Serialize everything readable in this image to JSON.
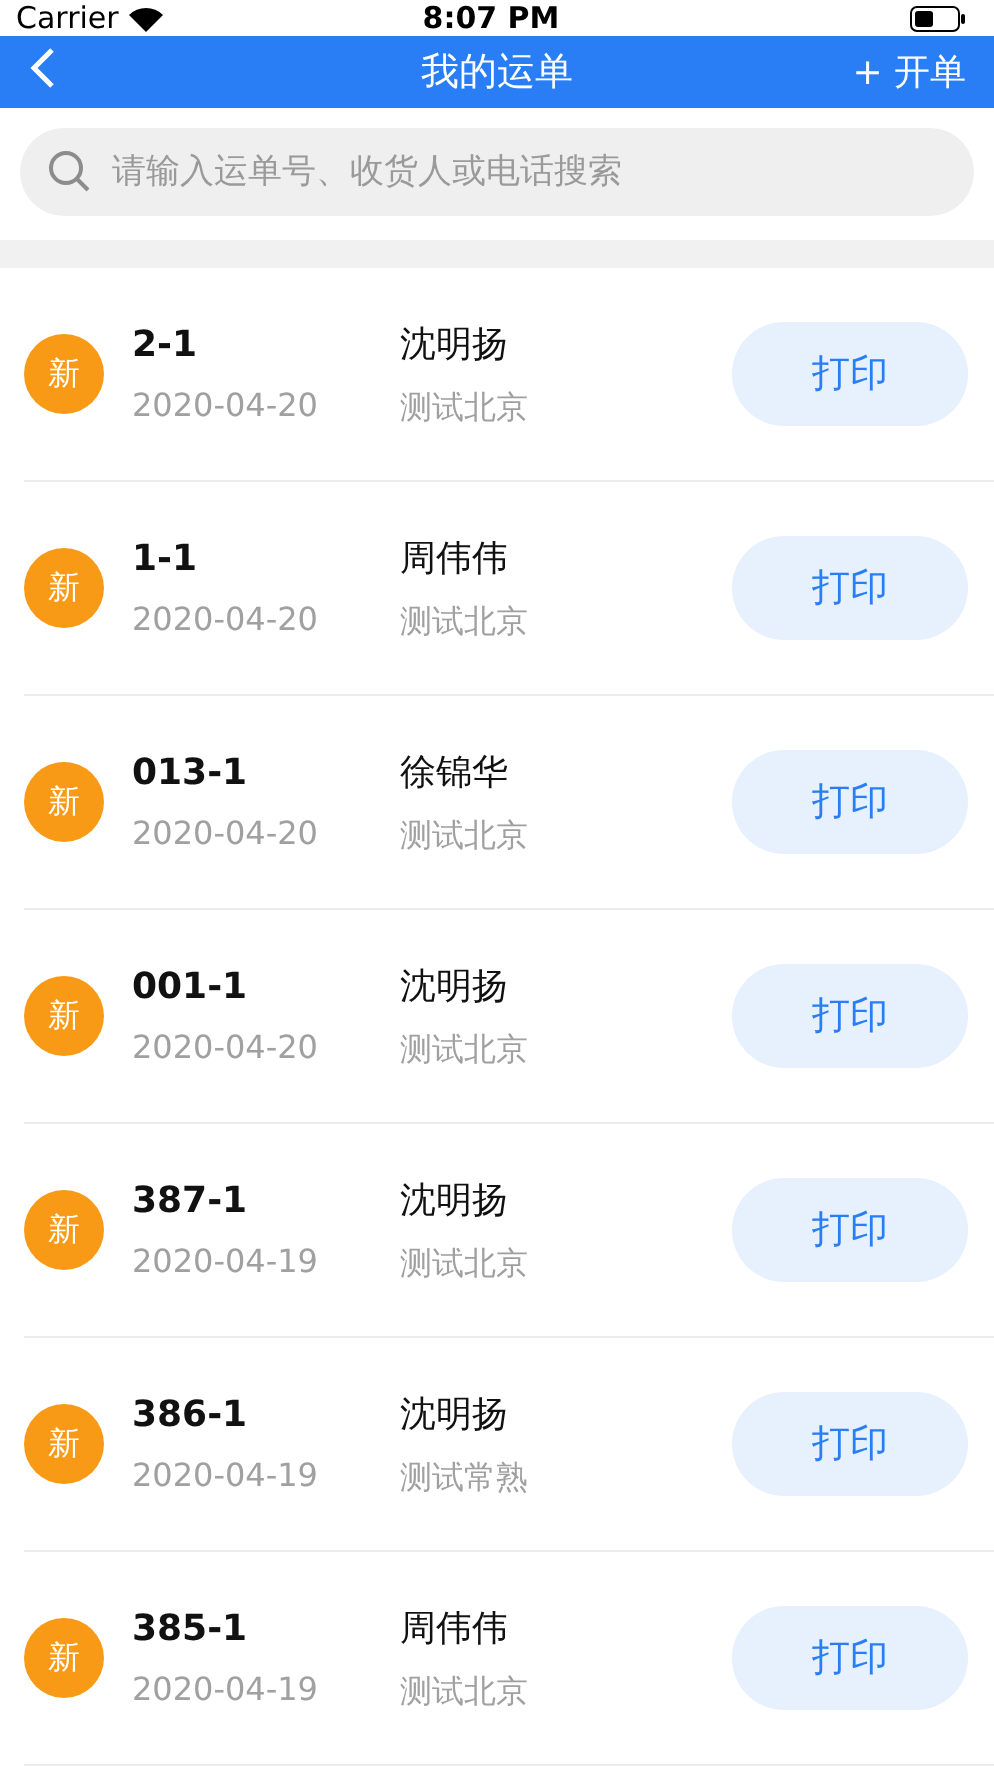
{
  "status_bar": {
    "carrier": "Carrier",
    "time": "8:07 PM"
  },
  "nav": {
    "title": "我的运单",
    "action": "+ 开单"
  },
  "search": {
    "placeholder": "请输入运单号、收货人或电话搜索"
  },
  "orders": [
    {
      "badge": "新",
      "number": "2-1",
      "date": "2020-04-20",
      "name": "沈明扬",
      "city": "测试北京",
      "button": "打印"
    },
    {
      "badge": "新",
      "number": "1-1",
      "date": "2020-04-20",
      "name": "周伟伟",
      "city": "测试北京",
      "button": "打印"
    },
    {
      "badge": "新",
      "number": "013-1",
      "date": "2020-04-20",
      "name": "徐锦华",
      "city": "测试北京",
      "button": "打印"
    },
    {
      "badge": "新",
      "number": "001-1",
      "date": "2020-04-20",
      "name": "沈明扬",
      "city": "测试北京",
      "button": "打印"
    },
    {
      "badge": "新",
      "number": "387-1",
      "date": "2020-04-19",
      "name": "沈明扬",
      "city": "测试北京",
      "button": "打印"
    },
    {
      "badge": "新",
      "number": "386-1",
      "date": "2020-04-19",
      "name": "沈明扬",
      "city": "测试常熟",
      "button": "打印"
    },
    {
      "badge": "新",
      "number": "385-1",
      "date": "2020-04-19",
      "name": "周伟伟",
      "city": "测试北京",
      "button": "打印"
    }
  ]
}
